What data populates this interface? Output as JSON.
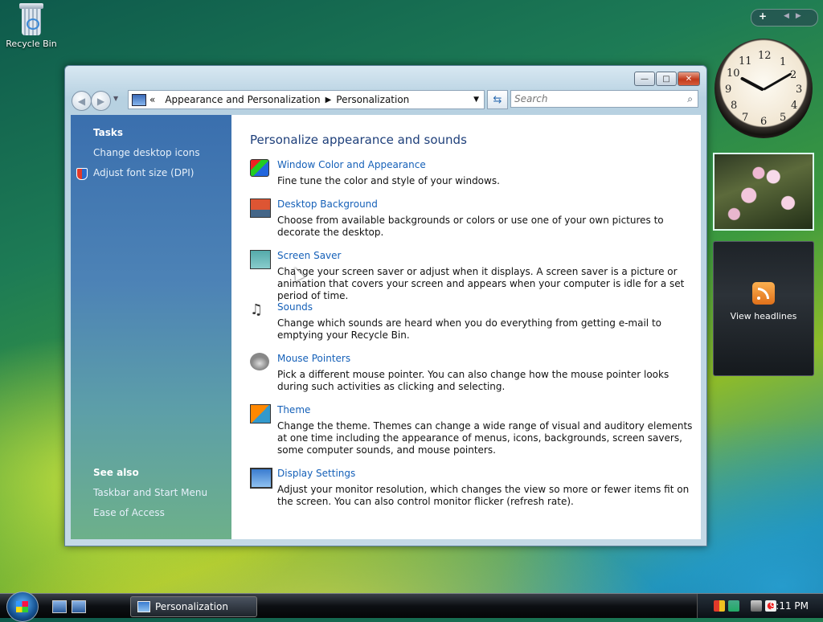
{
  "desktop": {
    "recycle_bin_label": "Recycle Bin"
  },
  "window": {
    "breadcrumb_lead": "«",
    "breadcrumb": [
      "Appearance and Personalization",
      "Personalization"
    ],
    "search_placeholder": "Search",
    "controls": {
      "minimize": "—",
      "maximize": "□",
      "close": "✕"
    }
  },
  "sidebar": {
    "tasks_heading": "Tasks",
    "tasks": [
      "Change desktop icons",
      "Adjust font size (DPI)"
    ],
    "see_also_heading": "See also",
    "see_also": [
      "Taskbar and Start Menu",
      "Ease of Access"
    ]
  },
  "content": {
    "title": "Personalize appearance and sounds",
    "items": [
      {
        "icon": "window-color-icon",
        "title": "Window Color and Appearance",
        "desc": "Fine tune the color and style of your windows."
      },
      {
        "icon": "desktop-background-icon",
        "title": "Desktop Background",
        "desc": "Choose from available backgrounds or colors or use one of your own pictures to decorate the desktop."
      },
      {
        "icon": "screen-saver-icon",
        "title": "Screen Saver",
        "desc": "Change your screen saver or adjust when it displays. A screen saver is a picture or animation that covers your screen and appears when your computer is idle for a set period of time."
      },
      {
        "icon": "sounds-icon",
        "title": "Sounds",
        "desc": "Change which sounds are heard when you do everything from getting e-mail to emptying your Recycle Bin."
      },
      {
        "icon": "mouse-pointers-icon",
        "title": "Mouse Pointers",
        "desc": "Pick a different mouse pointer. You can also change how the mouse pointer looks during such activities as clicking and selecting."
      },
      {
        "icon": "theme-icon",
        "title": "Theme",
        "desc": "Change the theme. Themes can change a wide range of visual and auditory elements at one time including the appearance of menus, icons, backgrounds, screen savers, some computer sounds, and mouse pointers."
      },
      {
        "icon": "display-settings-icon",
        "title": "Display Settings",
        "desc": "Adjust your monitor resolution, which changes the view so more or fewer items fit on the screen. You can also control monitor flicker (refresh rate)."
      }
    ]
  },
  "sidebar_gadgets": {
    "add_label": "+",
    "clock_numbers": [
      "12",
      "1",
      "2",
      "3",
      "4",
      "5",
      "6",
      "7",
      "8",
      "9",
      "10",
      "11"
    ],
    "feed_label": "View headlines"
  },
  "taskbar": {
    "task_label": "Personalization",
    "clock": "9:11 PM"
  }
}
